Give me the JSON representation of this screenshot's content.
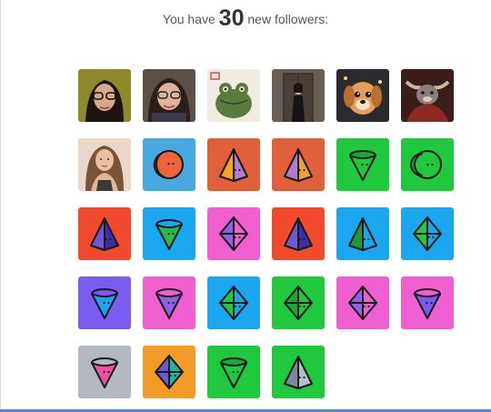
{
  "header": {
    "prefix": "You have",
    "count": "30",
    "suffix": "new followers:"
  },
  "followers": [
    {
      "kind": "photo",
      "subject": "woman-glasses",
      "bg": "#8c8a2a"
    },
    {
      "kind": "photo",
      "subject": "woman-glasses-2",
      "bg": "#5a5045"
    },
    {
      "kind": "photo",
      "subject": "frog",
      "bg": "#f1ece1"
    },
    {
      "kind": "photo",
      "subject": "woman-doorway",
      "bg": "#6a5d52"
    },
    {
      "kind": "photo",
      "subject": "puppy",
      "bg": "#2b2a2e"
    },
    {
      "kind": "photo",
      "subject": "bull",
      "bg": "#3a1c1a"
    },
    {
      "kind": "photo",
      "subject": "woman-portrait",
      "bg": "#ead8cb"
    },
    {
      "kind": "avatar",
      "shape": "moon-face",
      "bg": "#47a9e0",
      "fill": "#f0643c",
      "accent": "#6b4fa6"
    },
    {
      "kind": "avatar",
      "shape": "pyramid",
      "bg": "#e0603c",
      "fill": "#f2a22a",
      "accent": "#b07ed0"
    },
    {
      "kind": "avatar",
      "shape": "pyramid",
      "bg": "#e0603c",
      "fill": "#b07ed0",
      "accent": "#f2a22a"
    },
    {
      "kind": "avatar",
      "shape": "cone",
      "bg": "#1fc83d",
      "fill": "#1fc83d",
      "accent": "#18a833"
    },
    {
      "kind": "avatar",
      "shape": "moon",
      "bg": "#1fc83d",
      "fill": "#1fc83d",
      "accent": "#18a833"
    },
    {
      "kind": "avatar",
      "shape": "pyramid",
      "bg": "#f24a2c",
      "fill": "#6a5ad0",
      "accent": "#3b2fa6"
    },
    {
      "kind": "avatar",
      "shape": "cone",
      "bg": "#1aa7ef",
      "fill": "#2eb84a",
      "accent": "#1aa7ef"
    },
    {
      "kind": "avatar",
      "shape": "diamond",
      "bg": "#ef5fd0",
      "fill": "#ef5fd0",
      "accent": "#8a63e6"
    },
    {
      "kind": "avatar",
      "shape": "pyramid",
      "bg": "#f24a2c",
      "fill": "#6a5ad0",
      "accent": "#3b2fa6"
    },
    {
      "kind": "avatar",
      "shape": "pyramid",
      "bg": "#1aa7ef",
      "fill": "#1f9a3a",
      "accent": "#1aa7ef"
    },
    {
      "kind": "avatar",
      "shape": "diamond",
      "bg": "#1aa7ef",
      "fill": "#1aa7ef",
      "accent": "#1fc83d"
    },
    {
      "kind": "avatar",
      "shape": "cone",
      "bg": "#7b5cf0",
      "fill": "#1aa7ef",
      "accent": "#7b5cf0"
    },
    {
      "kind": "avatar",
      "shape": "cone",
      "bg": "#ef5fd0",
      "fill": "#8a63e6",
      "accent": "#ef5fd0"
    },
    {
      "kind": "avatar",
      "shape": "diamond",
      "bg": "#1aa7ef",
      "fill": "#1aa7ef",
      "accent": "#1fc83d"
    },
    {
      "kind": "avatar",
      "shape": "diamond",
      "bg": "#1fc83d",
      "fill": "#1fc83d",
      "accent": "#18a833"
    },
    {
      "kind": "avatar",
      "shape": "diamond",
      "bg": "#ef5fd0",
      "fill": "#ef5fd0",
      "accent": "#8a63e6"
    },
    {
      "kind": "avatar",
      "shape": "cone",
      "bg": "#ef5fd0",
      "fill": "#7b5cf0",
      "accent": "#ef5fd0"
    },
    {
      "kind": "avatar",
      "shape": "cone",
      "bg": "#b4b8bf",
      "fill": "#ef4fa0",
      "accent": "#b4b8bf"
    },
    {
      "kind": "avatar",
      "shape": "diamond",
      "bg": "#f49a26",
      "fill": "#1ab8a0",
      "accent": "#6a5ad0"
    },
    {
      "kind": "avatar",
      "shape": "cone",
      "bg": "#1fc83d",
      "fill": "#1fc83d",
      "accent": "#18a833"
    },
    {
      "kind": "avatar",
      "shape": "pyramid",
      "bg": "#1fc83d",
      "fill": "#7a8a96",
      "accent": "#b4c0c8"
    }
  ]
}
